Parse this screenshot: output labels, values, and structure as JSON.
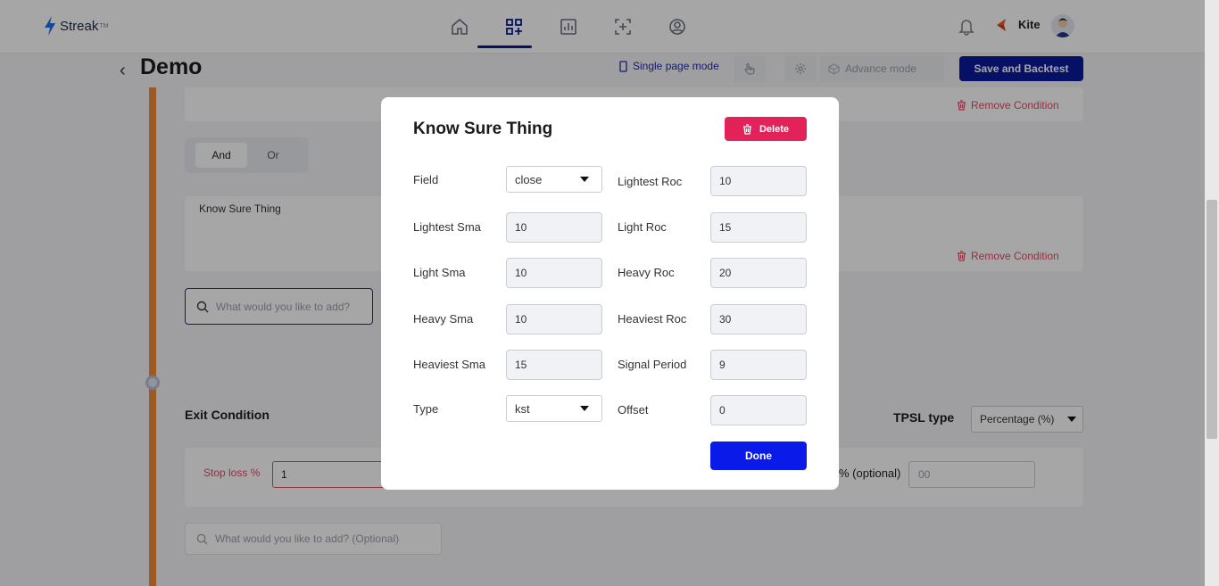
{
  "brand": {
    "name": "Streak",
    "mark": "TM"
  },
  "header": {
    "kite_label": "Kite",
    "page_title": "Demo",
    "single_page_mode": "Single page mode",
    "advance_mode": "Advance mode",
    "save_backtest": "Save and Backtest"
  },
  "main": {
    "remove_condition": "Remove Condition",
    "and_label": "And",
    "or_label": "Or",
    "condition_name": "Know Sure Thing",
    "search_placeholder": "What would you like to add?",
    "exit_title": "Exit Condition",
    "tpsl_type_label": "TPSL type",
    "tpsl_type_value": "Percentage (%)",
    "stop_loss_label": "Stop loss %",
    "stop_loss_value": "1",
    "optional_label_partial": "% (optional)",
    "optional_placeholder": "00",
    "exit_search_placeholder": "What would you like to add? (Optional)"
  },
  "modal": {
    "title": "Know Sure Thing",
    "delete_label": "Delete",
    "done_label": "Done",
    "fields": {
      "field": {
        "label": "Field",
        "value": "close"
      },
      "lightest_roc": {
        "label": "Lightest Roc",
        "value": "10"
      },
      "lightest_sma": {
        "label": "Lightest Sma",
        "value": "10"
      },
      "light_roc": {
        "label": "Light Roc",
        "value": "15"
      },
      "light_sma": {
        "label": "Light Sma",
        "value": "10"
      },
      "heavy_roc": {
        "label": "Heavy Roc",
        "value": "20"
      },
      "heavy_sma": {
        "label": "Heavy Sma",
        "value": "10"
      },
      "heaviest_roc": {
        "label": "Heaviest Roc",
        "value": "30"
      },
      "heaviest_sma": {
        "label": "Heaviest Sma",
        "value": "15"
      },
      "signal_period": {
        "label": "Signal Period",
        "value": "9"
      },
      "type": {
        "label": "Type",
        "value": "kst"
      },
      "offset": {
        "label": "Offset",
        "value": "0"
      }
    }
  },
  "colors": {
    "primary": "#0a1a9a",
    "done_blue": "#0a1ae8",
    "delete_red": "#e4225a",
    "timeline_orange": "#f08a3a",
    "danger_text": "#e34a65"
  }
}
